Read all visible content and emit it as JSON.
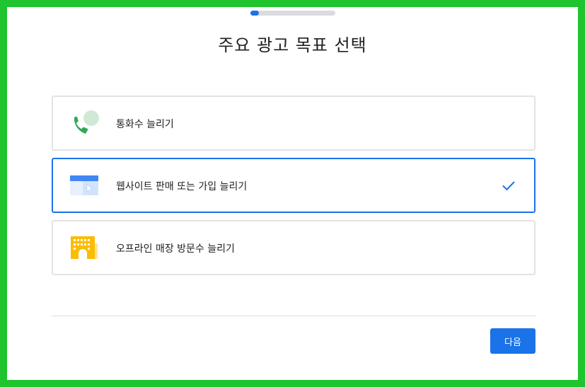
{
  "progress": {
    "fraction": 0.1,
    "fill_color": "#1a73e8"
  },
  "page": {
    "title": "주요 광고 목표 선택"
  },
  "options": [
    {
      "label": "통화수 늘리기",
      "icon": "phone-call-icon",
      "selected": false
    },
    {
      "label": "웹사이트 판매 또는 가입 늘리기",
      "icon": "website-browser-icon",
      "selected": true
    },
    {
      "label": "오프라인 매장 방문수 늘리기",
      "icon": "store-building-icon",
      "selected": false
    }
  ],
  "footer": {
    "next_label": "다음"
  },
  "colors": {
    "accent": "#1a73e8",
    "frame": "#1fc42e",
    "phone_green": "#34a853",
    "store_yellow": "#fbbc04"
  }
}
